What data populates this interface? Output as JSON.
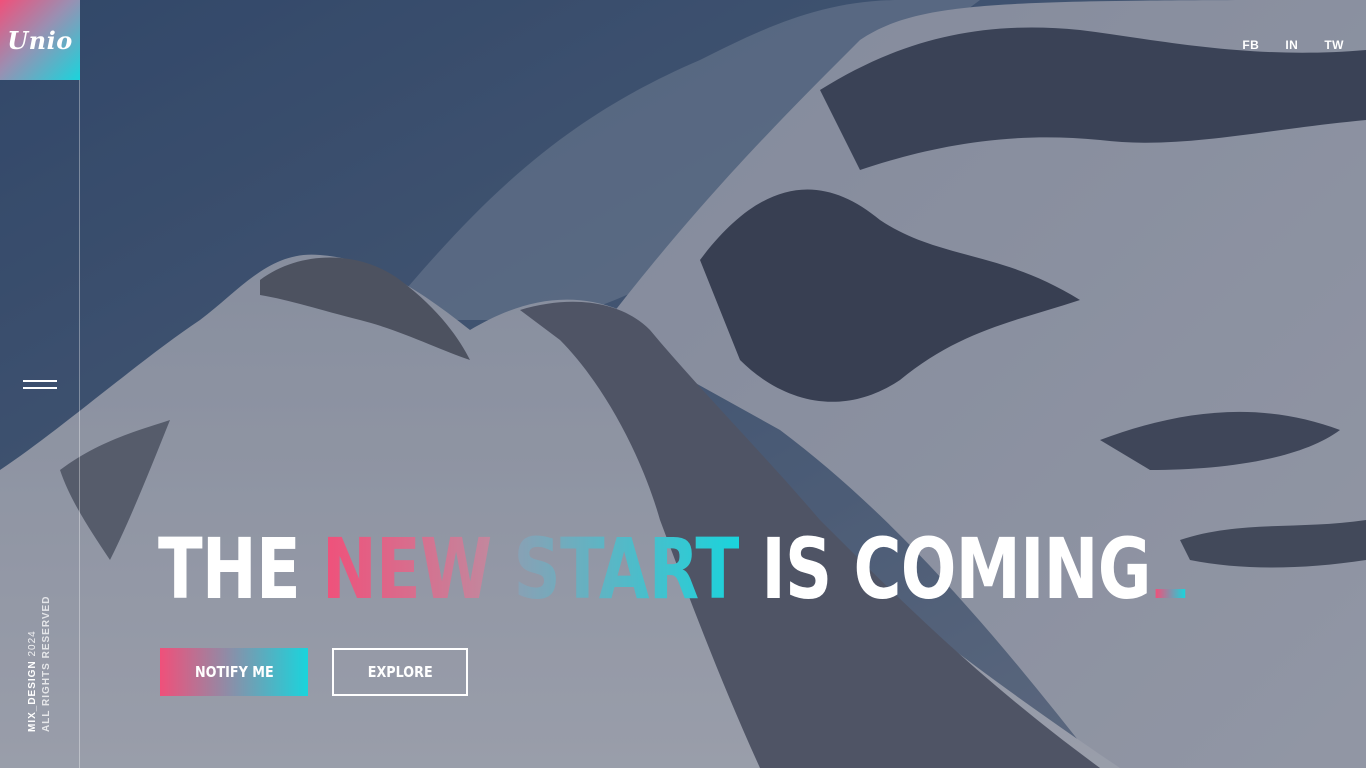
{
  "brand": {
    "logo_text": "Unio"
  },
  "sidebar": {
    "menu_icon": "hamburger-menu-icon",
    "copyright_brand": "MIX_DESIGN",
    "copyright_year": "2024",
    "copyright_rights": "ALL RIGHTS RESERVED"
  },
  "social": [
    {
      "label": "FB"
    },
    {
      "label": "IN"
    },
    {
      "label": "TW"
    }
  ],
  "hero": {
    "word1": "THE",
    "word2": "NEW",
    "word3": "START",
    "word4": "IS",
    "word5": "COMING"
  },
  "buttons": {
    "notify": "NOTIFY ME",
    "explore": "EXPLORE"
  },
  "colors": {
    "accent_pink": "#f0507a",
    "accent_cyan": "#1ad4dc",
    "overlay": "#1c243a"
  }
}
